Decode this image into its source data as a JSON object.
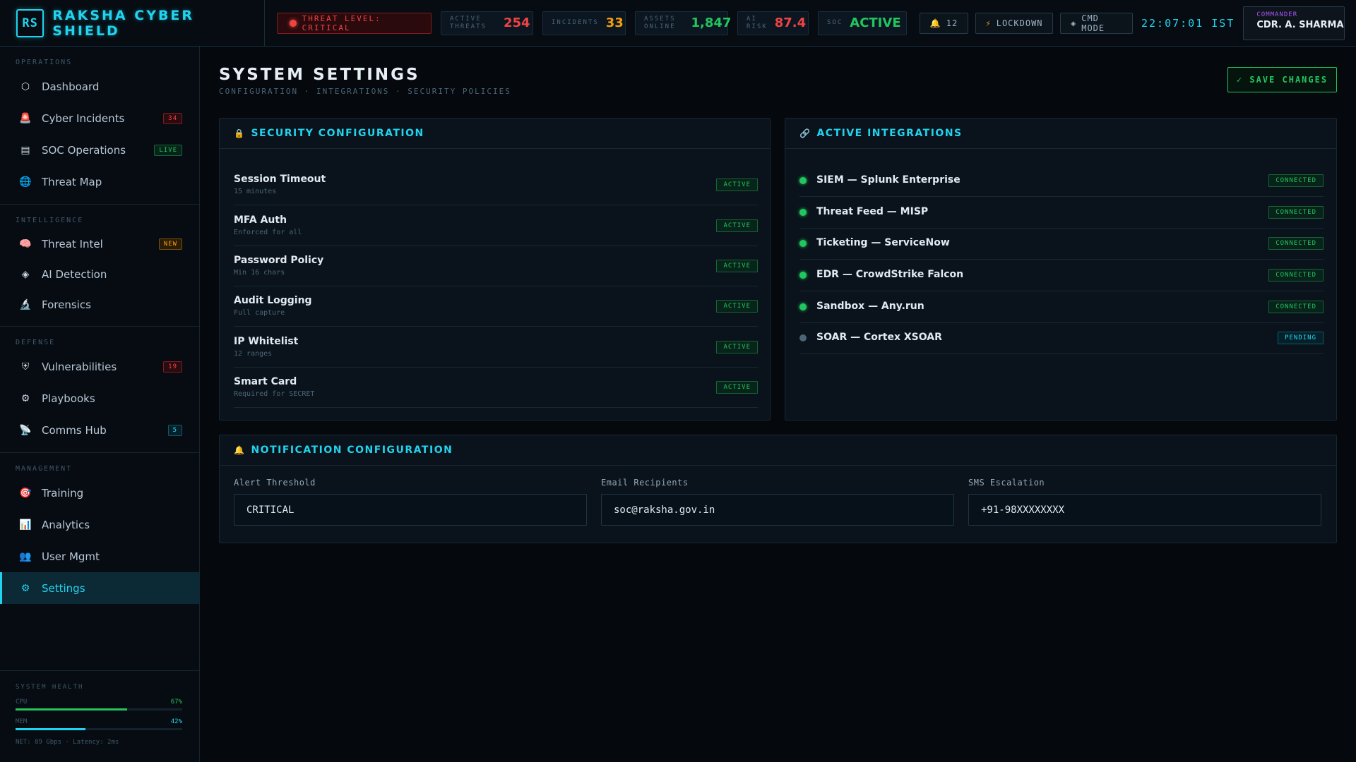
{
  "brand": {
    "logo": "RS",
    "name": "RAKSHA CYBER SHIELD"
  },
  "topbar": {
    "threat_level": "THREAT LEVEL: CRITICAL",
    "stats": [
      {
        "label1": "ACTIVE",
        "label2": "THREATS",
        "value": "254",
        "color": "#ef4444"
      },
      {
        "label1": "INCIDENTS",
        "label2": "",
        "value": "33",
        "color": "#f59e0b"
      },
      {
        "label1": "ASSETS",
        "label2": "ONLINE",
        "value": "1,847",
        "color": "#22c55e"
      },
      {
        "label1": "AI",
        "label2": "RISK",
        "value": "87.4",
        "color": "#ef4444"
      },
      {
        "label1": "SOC",
        "label2": "",
        "value": "ACTIVE",
        "color": "#22c55e"
      }
    ],
    "notifications": "12",
    "lockdown_label": "LOCKDOWN",
    "cmd_mode_label": "CMD MODE",
    "clock": "22:07:01 IST",
    "commander_label": "COMMANDER",
    "commander_name": "CDR. A. SHARMA"
  },
  "sidebar": {
    "sections": [
      {
        "title": "OPERATIONS",
        "items": [
          {
            "label": "Dashboard",
            "icon": "hexagon-icon",
            "badge": ""
          },
          {
            "label": "Cyber Incidents",
            "icon": "siren-icon",
            "badge": "34"
          },
          {
            "label": "SOC Operations",
            "icon": "server-icon",
            "badge": "LIVE"
          },
          {
            "label": "Threat Map",
            "icon": "globe-icon",
            "badge": ""
          }
        ]
      },
      {
        "title": "INTELLIGENCE",
        "items": [
          {
            "label": "Threat Intel",
            "icon": "brain-icon",
            "badge": "NEW"
          },
          {
            "label": "AI Detection",
            "icon": "diamond-icon",
            "badge": ""
          },
          {
            "label": "Forensics",
            "icon": "microscope-icon",
            "badge": ""
          }
        ]
      },
      {
        "title": "DEFENSE",
        "items": [
          {
            "label": "Vulnerabilities",
            "icon": "shield-icon",
            "badge": "19"
          },
          {
            "label": "Playbooks",
            "icon": "gear-icon",
            "badge": ""
          },
          {
            "label": "Comms Hub",
            "icon": "satellite-icon",
            "badge": "5"
          }
        ]
      },
      {
        "title": "MANAGEMENT",
        "items": [
          {
            "label": "Training",
            "icon": "target-icon",
            "badge": ""
          },
          {
            "label": "Analytics",
            "icon": "bar-chart-icon",
            "badge": ""
          },
          {
            "label": "User Mgmt",
            "icon": "users-icon",
            "badge": ""
          },
          {
            "label": "Settings",
            "icon": "gear-icon",
            "badge": ""
          }
        ]
      }
    ],
    "health": {
      "title": "SYSTEM HEALTH",
      "cpu_label": "CPU",
      "cpu_value": "67%",
      "cpu_fraction": 0.67,
      "mem_label": "MEM",
      "mem_value": "42%",
      "mem_fraction": 0.42,
      "net": "NET: 89 Gbps · Latency: 2ms"
    }
  },
  "main": {
    "title": "SYSTEM SETTINGS",
    "subtitle": "CONFIGURATION · INTEGRATIONS · SECURITY POLICIES",
    "save_label": "✓ SAVE CHANGES",
    "security": {
      "title": "SECURITY CONFIGURATION",
      "rows": [
        {
          "name": "Session Timeout",
          "desc": "15 minutes",
          "status": "ACTIVE"
        },
        {
          "name": "MFA Auth",
          "desc": "Enforced for all",
          "status": "ACTIVE"
        },
        {
          "name": "Password Policy",
          "desc": "Min 16 chars",
          "status": "ACTIVE"
        },
        {
          "name": "Audit Logging",
          "desc": "Full capture",
          "status": "ACTIVE"
        },
        {
          "name": "IP Whitelist",
          "desc": "12 ranges",
          "status": "ACTIVE"
        },
        {
          "name": "Smart Card",
          "desc": "Required for SECRET",
          "status": "ACTIVE"
        }
      ]
    },
    "integrations": {
      "title": "ACTIVE INTEGRATIONS",
      "rows": [
        {
          "name": "SIEM — Splunk Enterprise",
          "status": "CONNECTED"
        },
        {
          "name": "Threat Feed — MISP",
          "status": "CONNECTED"
        },
        {
          "name": "Ticketing — ServiceNow",
          "status": "CONNECTED"
        },
        {
          "name": "EDR — CrowdStrike Falcon",
          "status": "CONNECTED"
        },
        {
          "name": "Sandbox — Any.run",
          "status": "CONNECTED"
        },
        {
          "name": "SOAR — Cortex XSOAR",
          "status": "PENDING"
        }
      ]
    },
    "notifications": {
      "title": "NOTIFICATION CONFIGURATION",
      "fields": [
        {
          "label": "Alert Threshold",
          "value": "CRITICAL"
        },
        {
          "label": "Email Recipients",
          "value": "soc@raksha.gov.in"
        },
        {
          "label": "SMS Escalation",
          "value": "+91-98XXXXXXXX"
        }
      ]
    }
  },
  "colors": {
    "accent": "#22d3ee",
    "success": "#22c55e",
    "danger": "#ef4444",
    "warning": "#f59e0b",
    "purple": "#a855f7"
  }
}
